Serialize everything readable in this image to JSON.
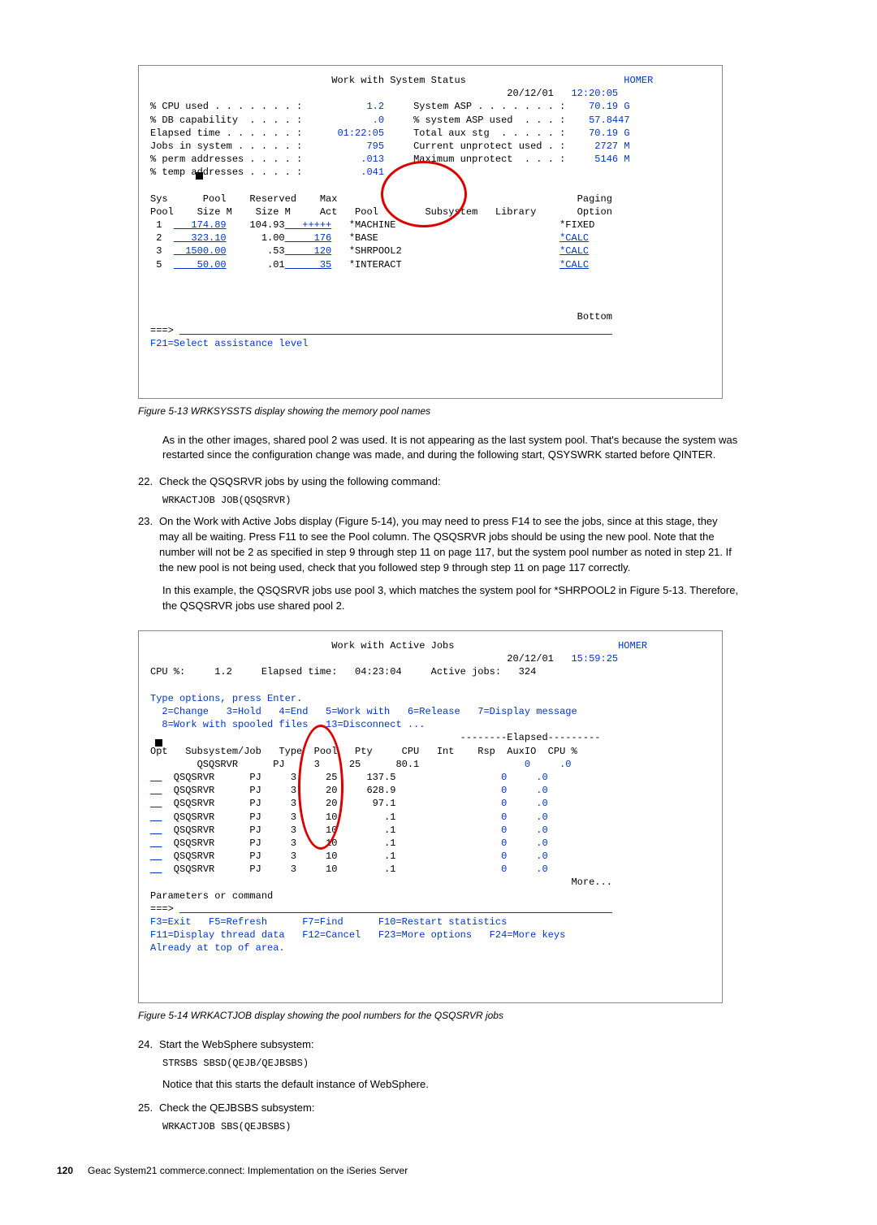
{
  "term1": {
    "title": "Work with System Status",
    "hostname": "HOMER",
    "date": "20/12/01",
    "time": "12:20:05",
    "stats_left": [
      {
        "label": "% CPU used . . . . . . . :",
        "value": "1.2"
      },
      {
        "label": "% DB capability  . . . . :",
        "value": ".0"
      },
      {
        "label": "Elapsed time . . . . . . :",
        "value": "01:22:05"
      },
      {
        "label": "Jobs in system . . . . . :",
        "value": "795"
      },
      {
        "label": "% perm addresses . . . . :",
        "value": ".013"
      },
      {
        "label": "% temp addresses . . . . :",
        "value": ".041"
      }
    ],
    "stats_right": [
      {
        "label": "System ASP . . . . . . . :",
        "value": "70.19 G"
      },
      {
        "label": "% system ASP used  . . . :",
        "value": "57.8447"
      },
      {
        "label": "Total aux stg  . . . . . :",
        "value": "70.19 G"
      },
      {
        "label": "Current unprotect used . :",
        "value": "2727 M"
      },
      {
        "label": "Maximum unprotect  . . . :",
        "value": "5146 M"
      }
    ],
    "table_header1": "Sys      Pool    Reserved    Max",
    "table_header2": "Pool    Size M    Size M     Act",
    "table_header_right": "Pool        Subsystem   Library      Paging\n                                     Option",
    "rows": [
      {
        "sys": "1",
        "size": "174.89",
        "res": "104.93",
        "act": "+++++",
        "pool": "*MACHINE",
        "paging": "*FIXED"
      },
      {
        "sys": "2",
        "size": "323.10",
        "res": "1.00",
        "act": "176",
        "pool": "*BASE",
        "paging": "*CALC"
      },
      {
        "sys": "3",
        "size": "1500.00",
        "res": ".53",
        "act": "120",
        "pool": "*SHRPOOL2",
        "paging": "*CALC"
      },
      {
        "sys": "5",
        "size": "50.00",
        "res": ".01",
        "act": "35",
        "pool": "*INTERACT",
        "paging": "*CALC"
      }
    ],
    "bottom": "Bottom",
    "prompt": "===>",
    "fkey": "F21=Select assistance level"
  },
  "caption1": "Figure 5-13   WRKSYSSTS display showing the memory pool names",
  "para1": "As in the other images, shared pool 2 was used. It is not appearing as the last system pool. That's because the system was restarted since the configuration change was made, and during the following start, QSYSWRK started before QINTER.",
  "step22_num": "22.",
  "step22_text": "Check the QSQSRVR jobs by using the following command:",
  "cmd22": "WRKACTJOB JOB(QSQSRVR)",
  "step23_num": "23.",
  "step23_text": "On the Work with Active Jobs display (Figure 5-14), you may need to press F14 to see the jobs, since at this stage, they may all be waiting. Press F11 to see the Pool column. The QSQSRVR jobs should be using the new pool. Note that the number will not be 2 as specified in step 9 through step 11 on page 117, but the system pool number as noted in step 21. If the new pool is not being used, check that you followed step 9 through step 11 on page 117 correctly.",
  "para23b": "In this example, the QSQSRVR jobs use pool 3, which matches the system pool for *SHRPOOL2 in Figure 5-13. Therefore, the QSQSRVR jobs use shared pool 2.",
  "term2": {
    "title": "Work with Active Jobs",
    "hostname": "HOMER",
    "date": "20/12/01",
    "time": "15:59:25",
    "line2": "CPU %:     1.2     Elapsed time:   04:23:04     Active jobs:   324",
    "instr1": "Type options, press Enter.",
    "instr2": "  2=Change   3=Hold   4=End   5=Work with   6=Release   7=Display message",
    "instr3": "  8=Work with spooled files   13=Disconnect ...",
    "elapsed_hdr": "--------Elapsed---------",
    "col_hdr": "Opt   Subsystem/Job   Type  Pool   Pty     CPU   Int    Rsp  AuxIO  CPU %",
    "rows": [
      {
        "job": "QSQSRVR",
        "type": "PJ",
        "pool": "3",
        "pty": "25",
        "cpu": "80.1",
        "aux": "0",
        "cpupct": ".0"
      },
      {
        "job": "QSQSRVR",
        "type": "PJ",
        "pool": "3",
        "pty": "25",
        "cpu": "137.5",
        "aux": "0",
        "cpupct": ".0"
      },
      {
        "job": "QSQSRVR",
        "type": "PJ",
        "pool": "3",
        "pty": "20",
        "cpu": "628.9",
        "aux": "0",
        "cpupct": ".0"
      },
      {
        "job": "QSQSRVR",
        "type": "PJ",
        "pool": "3",
        "pty": "20",
        "cpu": "97.1",
        "aux": "0",
        "cpupct": ".0"
      },
      {
        "job": "QSQSRVR",
        "type": "PJ",
        "pool": "3",
        "pty": "10",
        "cpu": ".1",
        "aux": "0",
        "cpupct": ".0"
      },
      {
        "job": "QSQSRVR",
        "type": "PJ",
        "pool": "3",
        "pty": "10",
        "cpu": ".1",
        "aux": "0",
        "cpupct": ".0"
      },
      {
        "job": "QSQSRVR",
        "type": "PJ",
        "pool": "3",
        "pty": "10",
        "cpu": ".1",
        "aux": "0",
        "cpupct": ".0"
      },
      {
        "job": "QSQSRVR",
        "type": "PJ",
        "pool": "3",
        "pty": "10",
        "cpu": ".1",
        "aux": "0",
        "cpupct": ".0"
      },
      {
        "job": "QSQSRVR",
        "type": "PJ",
        "pool": "3",
        "pty": "10",
        "cpu": ".1",
        "aux": "0",
        "cpupct": ".0"
      }
    ],
    "more": "More...",
    "param": "Parameters or command",
    "prompt": "===>",
    "fkeys1": "F3=Exit   F5=Refresh      F7=Find      F10=Restart statistics",
    "fkeys2": "F11=Display thread data   F12=Cancel   F23=More options   F24=More keys",
    "status": "Already at top of area."
  },
  "caption2": "Figure 5-14   WRKACTJOB display showing the pool numbers for the QSQSRVR jobs",
  "step24_num": "24.",
  "step24_text": "Start the WebSphere subsystem:",
  "cmd24": "STRSBS SBSD(QEJB/QEJBSBS)",
  "para24": "Notice that this starts the default instance of WebSphere.",
  "step25_num": "25.",
  "step25_text": "Check the QEJBSBS subsystem:",
  "cmd25": "WRKACTJOB SBS(QEJBSBS)",
  "footer_page": "120",
  "footer_text": "Geac System21 commerce.connect: Implementation on the iSeries Server"
}
